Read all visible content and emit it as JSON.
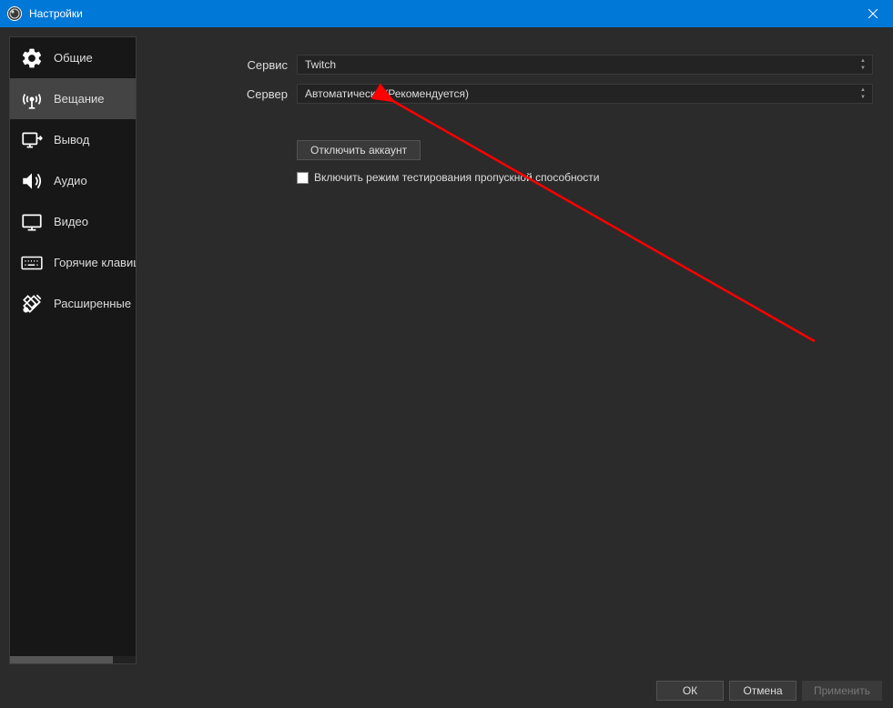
{
  "window": {
    "title": "Настройки"
  },
  "sidebar": {
    "items": [
      {
        "label": "Общие"
      },
      {
        "label": "Вещание"
      },
      {
        "label": "Вывод"
      },
      {
        "label": "Аудио"
      },
      {
        "label": "Видео"
      },
      {
        "label": "Горячие клавиши"
      },
      {
        "label": "Расширенные"
      }
    ]
  },
  "form": {
    "service_label": "Сервис",
    "service_value": "Twitch",
    "server_label": "Сервер",
    "server_value": "Автоматически (Рекомендуется)",
    "disconnect_button": "Отключить аккаунт",
    "bandwidth_test_label": "Включить режим тестирования пропускной способности"
  },
  "footer": {
    "ok": "ОК",
    "cancel": "Отмена",
    "apply": "Применить"
  }
}
